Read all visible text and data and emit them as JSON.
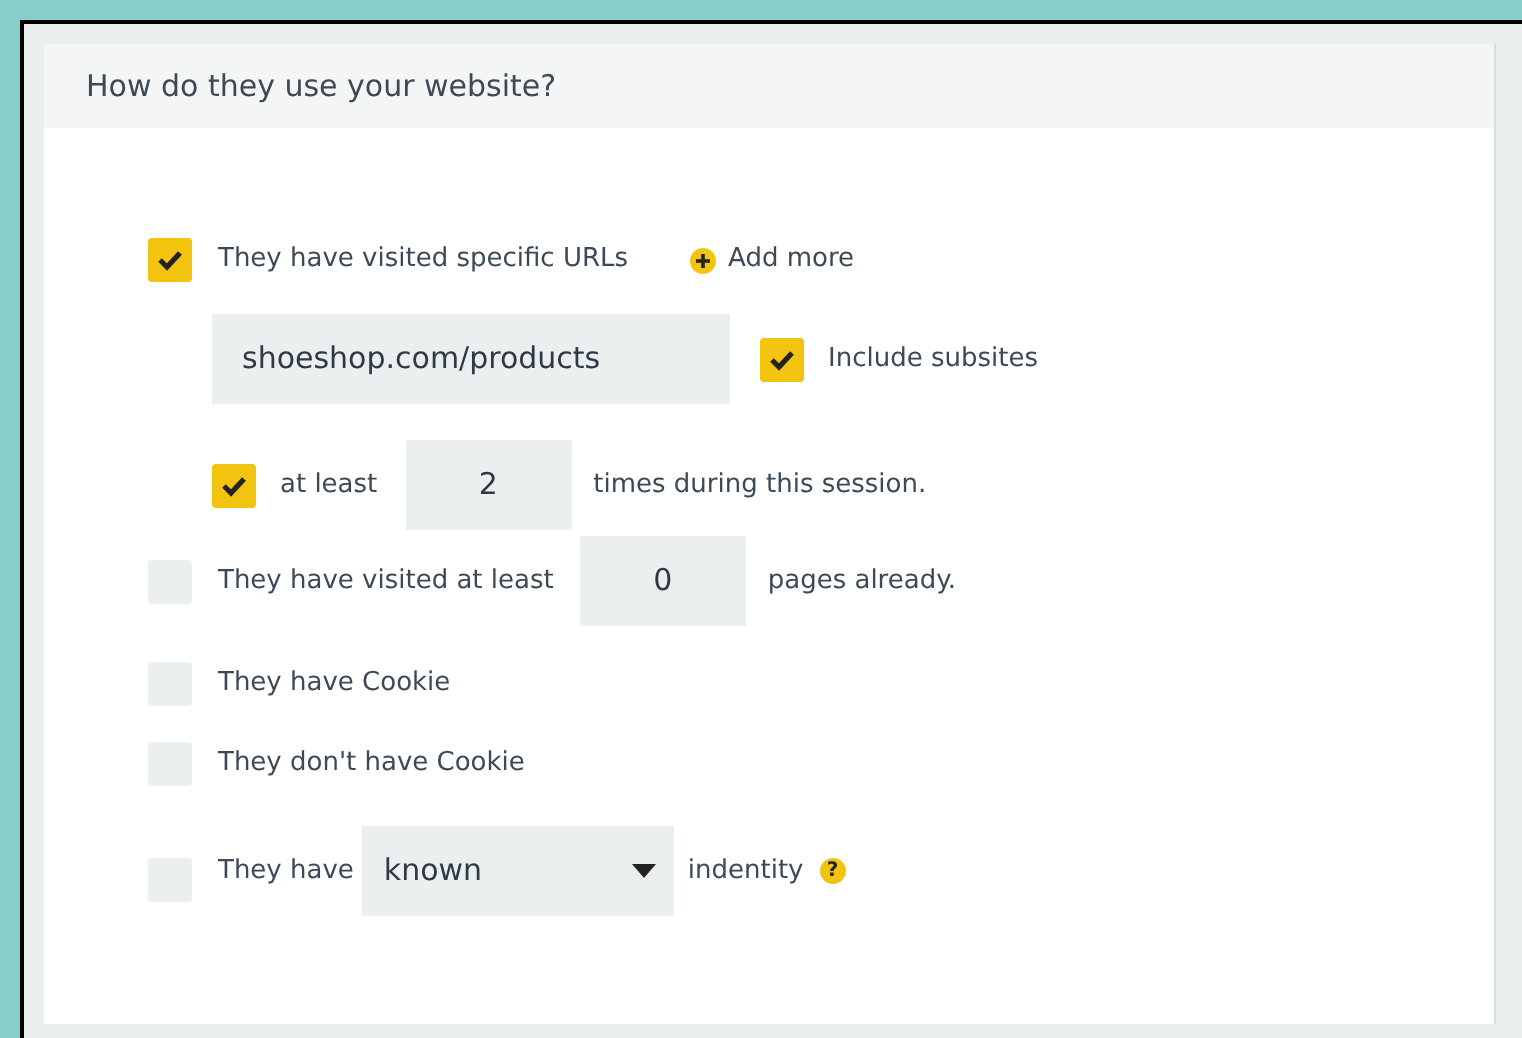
{
  "section": {
    "title": "How do they use your website?"
  },
  "conditions": [
    {
      "kind": "urls",
      "label": "They have visited specific URLs",
      "checked": true,
      "add_more": "Add more",
      "url": "shoeshop.com/products",
      "include_subsites": {
        "label": "Include subsites",
        "checked": true
      },
      "frequency": {
        "checked": true,
        "before": "at least",
        "value": "2",
        "after": "times during this session."
      }
    },
    {
      "kind": "count",
      "checked": false,
      "before": "They have visited at least",
      "value": "0",
      "after": "pages already."
    },
    {
      "kind": "plain",
      "checked": false,
      "label": "They have Cookie"
    },
    {
      "kind": "plain",
      "checked": false,
      "label": "They don't have Cookie"
    },
    {
      "kind": "select",
      "checked": false,
      "before": "They have",
      "value": "known",
      "after": "indentity",
      "help": "?"
    }
  ]
}
